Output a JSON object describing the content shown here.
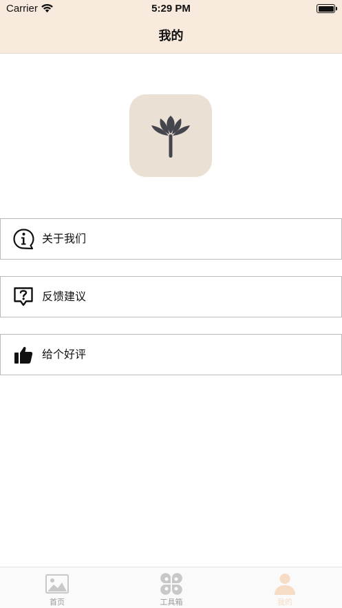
{
  "status_bar": {
    "carrier": "Carrier",
    "time": "5:29 PM"
  },
  "nav": {
    "title": "我的"
  },
  "colors": {
    "header_bg": "#f8eadc",
    "app_icon_bg": "#eae1d4",
    "icon_dark": "#45454d",
    "tab_inactive": "#c8c8c8",
    "tab_active": "#f6dcc4"
  },
  "app_icon": {
    "icon": "lotus-icon"
  },
  "menu": [
    {
      "label": "关于我们",
      "icon": "info-bubble-icon"
    },
    {
      "label": "反馈建议",
      "icon": "question-bubble-icon"
    },
    {
      "label": "给个好评",
      "icon": "thumbs-up-icon"
    }
  ],
  "tabbar": {
    "tabs": [
      {
        "label": "首页",
        "icon": "image-icon",
        "selected": false
      },
      {
        "label": "工具箱",
        "icon": "clover-icon",
        "selected": false
      },
      {
        "label": "我的",
        "icon": "person-icon",
        "selected": true
      }
    ]
  }
}
